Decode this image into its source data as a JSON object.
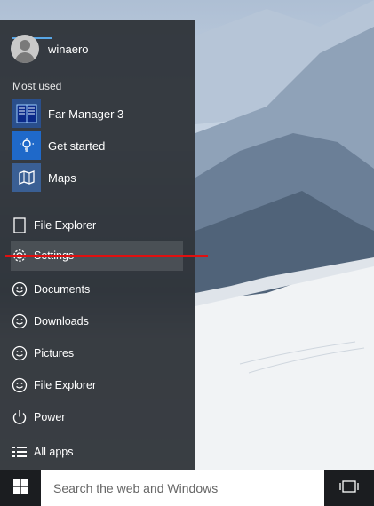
{
  "start_menu": {
    "user": {
      "name": "winaero",
      "icon": "user-avatar-icon"
    },
    "most_used_title": "Most used",
    "apps": [
      {
        "label": "Far Manager 3",
        "icon": "far-manager-icon"
      },
      {
        "label": "Get started",
        "icon": "lightbulb-icon"
      },
      {
        "label": "Maps",
        "icon": "maps-icon"
      }
    ],
    "places": [
      {
        "label": "File Explorer",
        "icon": "file-explorer-icon"
      },
      {
        "label": "Settings",
        "icon": "gear-icon",
        "selected": true
      },
      {
        "label": "Documents",
        "icon": "smiley-icon"
      },
      {
        "label": "Downloads",
        "icon": "smiley-icon"
      },
      {
        "label": "Pictures",
        "icon": "smiley-icon"
      },
      {
        "label": "File Explorer",
        "icon": "smiley-icon"
      },
      {
        "label": "Power",
        "icon": "power-icon"
      },
      {
        "label": "All apps",
        "icon": "all-apps-icon"
      }
    ]
  },
  "taskbar": {
    "search_placeholder": "Search the web and Windows",
    "start_icon": "windows-logo-icon",
    "task_view_icon": "task-view-icon"
  },
  "colors": {
    "accent": "#58a6e6",
    "annotation_underline": "#e01010",
    "menu_background": "#2b2f35"
  }
}
